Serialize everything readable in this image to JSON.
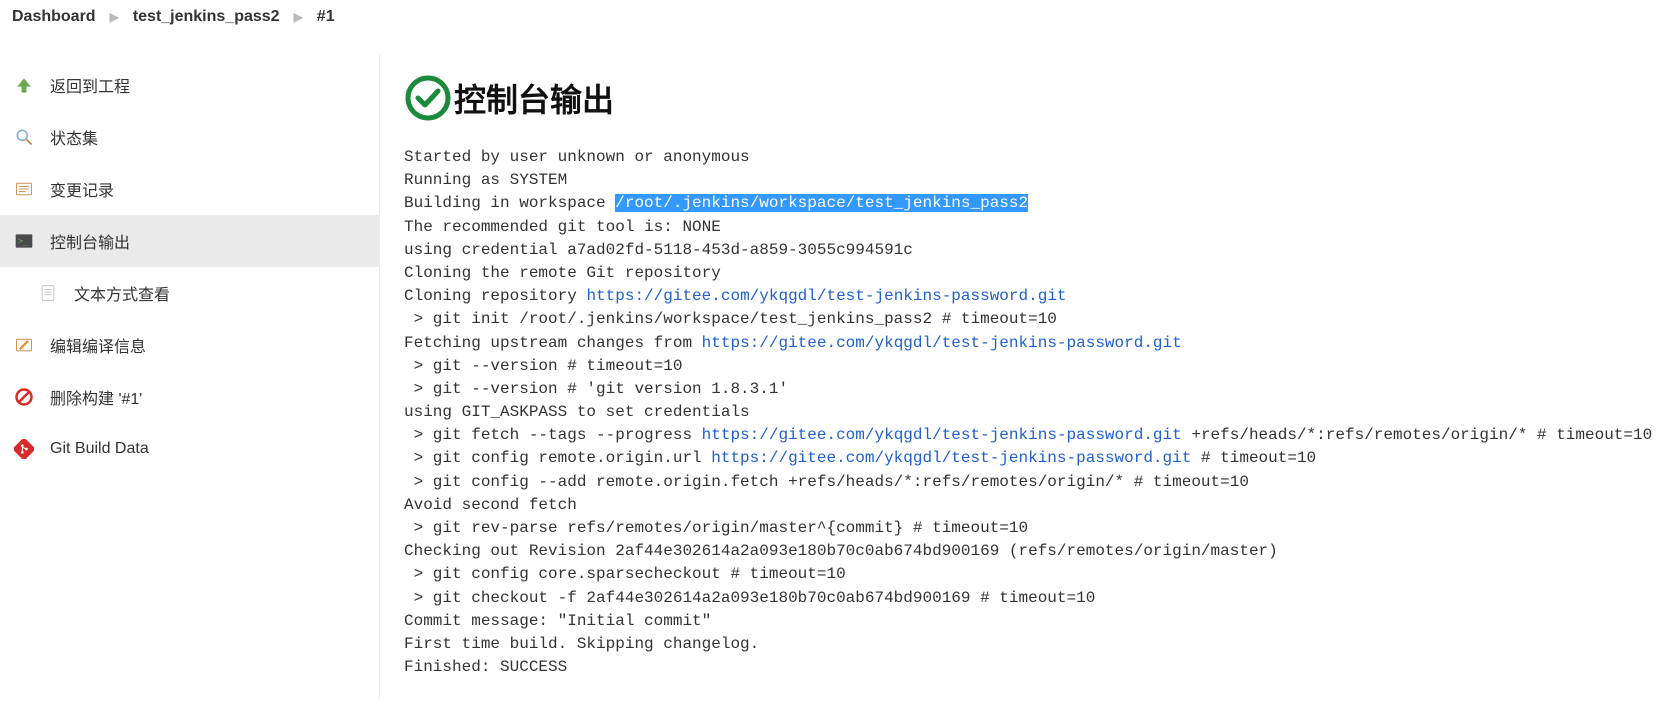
{
  "breadcrumbs": {
    "item0": "Dashboard",
    "item1": "test_jenkins_pass2",
    "item2": "#1"
  },
  "sidebar": {
    "back": "返回到工程",
    "status": "状态集",
    "changes": "变更记录",
    "console": "控制台输出",
    "plaintext": "文本方式查看",
    "editBuild": "编辑编译信息",
    "deleteBuild": "删除构建 '#1'",
    "gitBuildData": "Git Build Data"
  },
  "page": {
    "title": "控制台输出"
  },
  "console": {
    "l1": "Started by user unknown or anonymous",
    "l2": "Running as SYSTEM",
    "l3a": "Building in workspace ",
    "l3b": "/root/.jenkins/workspace/test_jenkins_pass2",
    "l4": "The recommended git tool is: NONE",
    "l5": "using credential a7ad02fd-5118-453d-a859-3055c994591c",
    "l6": "Cloning the remote Git repository",
    "l7a": "Cloning repository ",
    "l7link": "https://gitee.com/ykqgdl/test-jenkins-password.git",
    "l8": " > git init /root/.jenkins/workspace/test_jenkins_pass2 # timeout=10",
    "l9a": "Fetching upstream changes from ",
    "l9link": "https://gitee.com/ykqgdl/test-jenkins-password.git",
    "l10": " > git --version # timeout=10",
    "l11": " > git --version # 'git version 1.8.3.1'",
    "l12": "using GIT_ASKPASS to set credentials ",
    "l13a": " > git fetch --tags --progress ",
    "l13link": "https://gitee.com/ykqgdl/test-jenkins-password.git",
    "l13b": " +refs/heads/*:refs/remotes/origin/* # timeout=10",
    "l14a": " > git config remote.origin.url ",
    "l14link": "https://gitee.com/ykqgdl/test-jenkins-password.git",
    "l14b": " # timeout=10",
    "l15": " > git config --add remote.origin.fetch +refs/heads/*:refs/remotes/origin/* # timeout=10",
    "l16": "Avoid second fetch",
    "l17": " > git rev-parse refs/remotes/origin/master^{commit} # timeout=10",
    "l18": "Checking out Revision 2af44e302614a2a093e180b70c0ab674bd900169 (refs/remotes/origin/master)",
    "l19": " > git config core.sparsecheckout # timeout=10",
    "l20": " > git checkout -f 2af44e302614a2a093e180b70c0ab674bd900169 # timeout=10",
    "l21": "Commit message: \"Initial commit\"",
    "l22": "First time build. Skipping changelog.",
    "l23": "Finished: SUCCESS"
  }
}
